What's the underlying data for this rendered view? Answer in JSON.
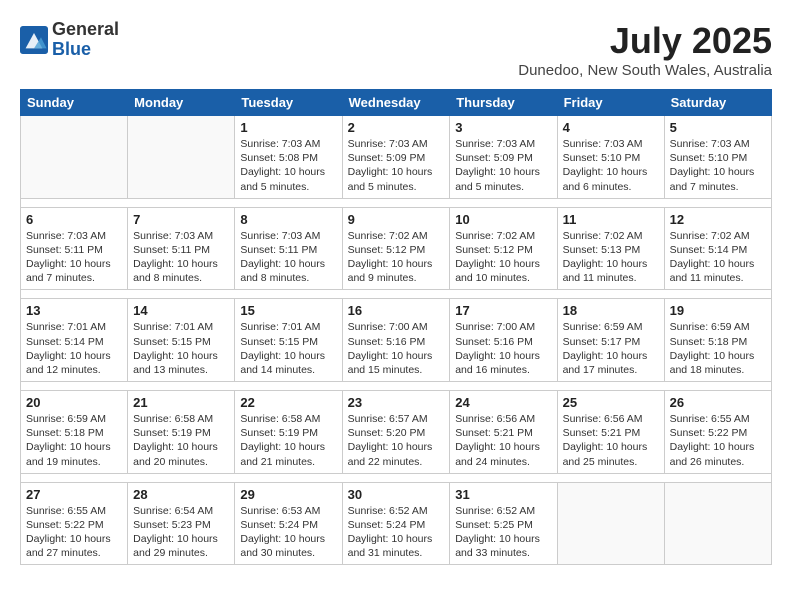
{
  "header": {
    "logo_general": "General",
    "logo_blue": "Blue",
    "month": "July 2025",
    "location": "Dunedoo, New South Wales, Australia"
  },
  "days_of_week": [
    "Sunday",
    "Monday",
    "Tuesday",
    "Wednesday",
    "Thursday",
    "Friday",
    "Saturday"
  ],
  "weeks": [
    [
      {
        "day": "",
        "info": ""
      },
      {
        "day": "",
        "info": ""
      },
      {
        "day": "1",
        "info": "Sunrise: 7:03 AM\nSunset: 5:08 PM\nDaylight: 10 hours\nand 5 minutes."
      },
      {
        "day": "2",
        "info": "Sunrise: 7:03 AM\nSunset: 5:09 PM\nDaylight: 10 hours\nand 5 minutes."
      },
      {
        "day": "3",
        "info": "Sunrise: 7:03 AM\nSunset: 5:09 PM\nDaylight: 10 hours\nand 5 minutes."
      },
      {
        "day": "4",
        "info": "Sunrise: 7:03 AM\nSunset: 5:10 PM\nDaylight: 10 hours\nand 6 minutes."
      },
      {
        "day": "5",
        "info": "Sunrise: 7:03 AM\nSunset: 5:10 PM\nDaylight: 10 hours\nand 7 minutes."
      }
    ],
    [
      {
        "day": "6",
        "info": "Sunrise: 7:03 AM\nSunset: 5:11 PM\nDaylight: 10 hours\nand 7 minutes."
      },
      {
        "day": "7",
        "info": "Sunrise: 7:03 AM\nSunset: 5:11 PM\nDaylight: 10 hours\nand 8 minutes."
      },
      {
        "day": "8",
        "info": "Sunrise: 7:03 AM\nSunset: 5:11 PM\nDaylight: 10 hours\nand 8 minutes."
      },
      {
        "day": "9",
        "info": "Sunrise: 7:02 AM\nSunset: 5:12 PM\nDaylight: 10 hours\nand 9 minutes."
      },
      {
        "day": "10",
        "info": "Sunrise: 7:02 AM\nSunset: 5:12 PM\nDaylight: 10 hours\nand 10 minutes."
      },
      {
        "day": "11",
        "info": "Sunrise: 7:02 AM\nSunset: 5:13 PM\nDaylight: 10 hours\nand 11 minutes."
      },
      {
        "day": "12",
        "info": "Sunrise: 7:02 AM\nSunset: 5:14 PM\nDaylight: 10 hours\nand 11 minutes."
      }
    ],
    [
      {
        "day": "13",
        "info": "Sunrise: 7:01 AM\nSunset: 5:14 PM\nDaylight: 10 hours\nand 12 minutes."
      },
      {
        "day": "14",
        "info": "Sunrise: 7:01 AM\nSunset: 5:15 PM\nDaylight: 10 hours\nand 13 minutes."
      },
      {
        "day": "15",
        "info": "Sunrise: 7:01 AM\nSunset: 5:15 PM\nDaylight: 10 hours\nand 14 minutes."
      },
      {
        "day": "16",
        "info": "Sunrise: 7:00 AM\nSunset: 5:16 PM\nDaylight: 10 hours\nand 15 minutes."
      },
      {
        "day": "17",
        "info": "Sunrise: 7:00 AM\nSunset: 5:16 PM\nDaylight: 10 hours\nand 16 minutes."
      },
      {
        "day": "18",
        "info": "Sunrise: 6:59 AM\nSunset: 5:17 PM\nDaylight: 10 hours\nand 17 minutes."
      },
      {
        "day": "19",
        "info": "Sunrise: 6:59 AM\nSunset: 5:18 PM\nDaylight: 10 hours\nand 18 minutes."
      }
    ],
    [
      {
        "day": "20",
        "info": "Sunrise: 6:59 AM\nSunset: 5:18 PM\nDaylight: 10 hours\nand 19 minutes."
      },
      {
        "day": "21",
        "info": "Sunrise: 6:58 AM\nSunset: 5:19 PM\nDaylight: 10 hours\nand 20 minutes."
      },
      {
        "day": "22",
        "info": "Sunrise: 6:58 AM\nSunset: 5:19 PM\nDaylight: 10 hours\nand 21 minutes."
      },
      {
        "day": "23",
        "info": "Sunrise: 6:57 AM\nSunset: 5:20 PM\nDaylight: 10 hours\nand 22 minutes."
      },
      {
        "day": "24",
        "info": "Sunrise: 6:56 AM\nSunset: 5:21 PM\nDaylight: 10 hours\nand 24 minutes."
      },
      {
        "day": "25",
        "info": "Sunrise: 6:56 AM\nSunset: 5:21 PM\nDaylight: 10 hours\nand 25 minutes."
      },
      {
        "day": "26",
        "info": "Sunrise: 6:55 AM\nSunset: 5:22 PM\nDaylight: 10 hours\nand 26 minutes."
      }
    ],
    [
      {
        "day": "27",
        "info": "Sunrise: 6:55 AM\nSunset: 5:22 PM\nDaylight: 10 hours\nand 27 minutes."
      },
      {
        "day": "28",
        "info": "Sunrise: 6:54 AM\nSunset: 5:23 PM\nDaylight: 10 hours\nand 29 minutes."
      },
      {
        "day": "29",
        "info": "Sunrise: 6:53 AM\nSunset: 5:24 PM\nDaylight: 10 hours\nand 30 minutes."
      },
      {
        "day": "30",
        "info": "Sunrise: 6:52 AM\nSunset: 5:24 PM\nDaylight: 10 hours\nand 31 minutes."
      },
      {
        "day": "31",
        "info": "Sunrise: 6:52 AM\nSunset: 5:25 PM\nDaylight: 10 hours\nand 33 minutes."
      },
      {
        "day": "",
        "info": ""
      },
      {
        "day": "",
        "info": ""
      }
    ]
  ]
}
